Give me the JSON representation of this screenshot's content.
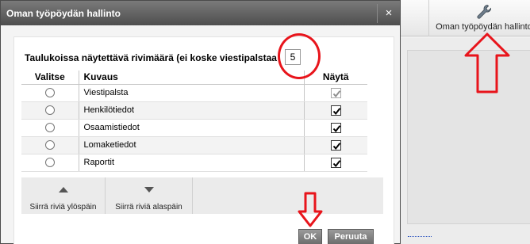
{
  "background": {
    "toolbar_item_label": "Oman työpöydän hallinto",
    "toolbar_item_icon": "wrench-icon"
  },
  "dialog": {
    "title": "Oman työpöydän hallinto",
    "close_label": "×",
    "rows_label": "Taulukoissa näytettävä rivimäärä (ei koske viestipalstaa",
    "rows_value": "5",
    "table": {
      "headers": {
        "select": "Valitse",
        "description": "Kuvaus",
        "show": "Näytä"
      },
      "rows": [
        {
          "description": "Viestipalsta",
          "show": true,
          "disabled": true
        },
        {
          "description": "Henkilötiedot",
          "show": true,
          "disabled": false
        },
        {
          "description": "Osaamistiedot",
          "show": true,
          "disabled": false
        },
        {
          "description": "Lomaketiedot",
          "show": true,
          "disabled": false
        },
        {
          "description": "Raportit",
          "show": true,
          "disabled": false
        }
      ]
    },
    "move_up_label": "Siirrä riviä ylöspäin",
    "move_down_label": "Siirrä riviä alaspäin",
    "ok_label": "OK",
    "cancel_label": "Peruuta"
  },
  "colors": {
    "annotation": "#e8141b",
    "titlebar": "#5a5a5a"
  }
}
